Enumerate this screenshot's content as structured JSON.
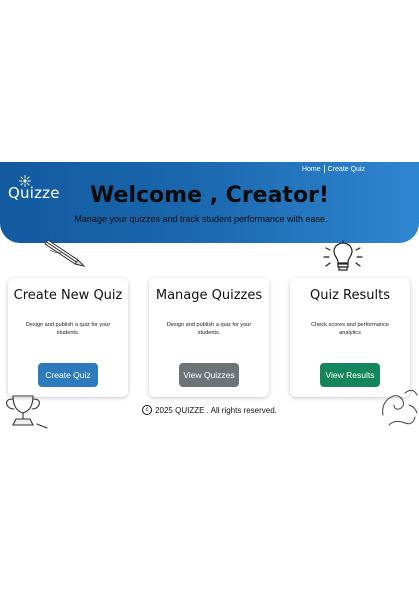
{
  "brand": {
    "name": "Quizze"
  },
  "nav": {
    "items": [
      {
        "label": "Home"
      },
      {
        "label": "Create Quiz"
      }
    ]
  },
  "hero": {
    "title": "Welcome , Creator!",
    "subtitle": "Manage your quizzes and track student performance with ease.",
    "gradient_start": "#135a9f",
    "gradient_end": "#2f86d0"
  },
  "cards": [
    {
      "title": "Create New Quiz",
      "description": "Design and publish a quiz for your students.",
      "button_label": "Create Quiz",
      "button_color": "#2b7bbd"
    },
    {
      "title": "Manage Quizzes",
      "description": "Design and publish a quiz for your students.",
      "button_label": "View Quizzes",
      "button_color": "#6e7378"
    },
    {
      "title": "Quiz Results",
      "description": "Check scores and performance analytics",
      "button_label": "View Results",
      "button_color": "#14855d"
    }
  ],
  "footer": {
    "copyright_icon": "copyright-icon",
    "text": "2025 QUIZZE . All rights reserved."
  },
  "decorations": [
    "pencil-doodle-icon",
    "lightbulb-doodle-icon",
    "trophy-doodle-icon",
    "swirl-doodle-icon"
  ]
}
